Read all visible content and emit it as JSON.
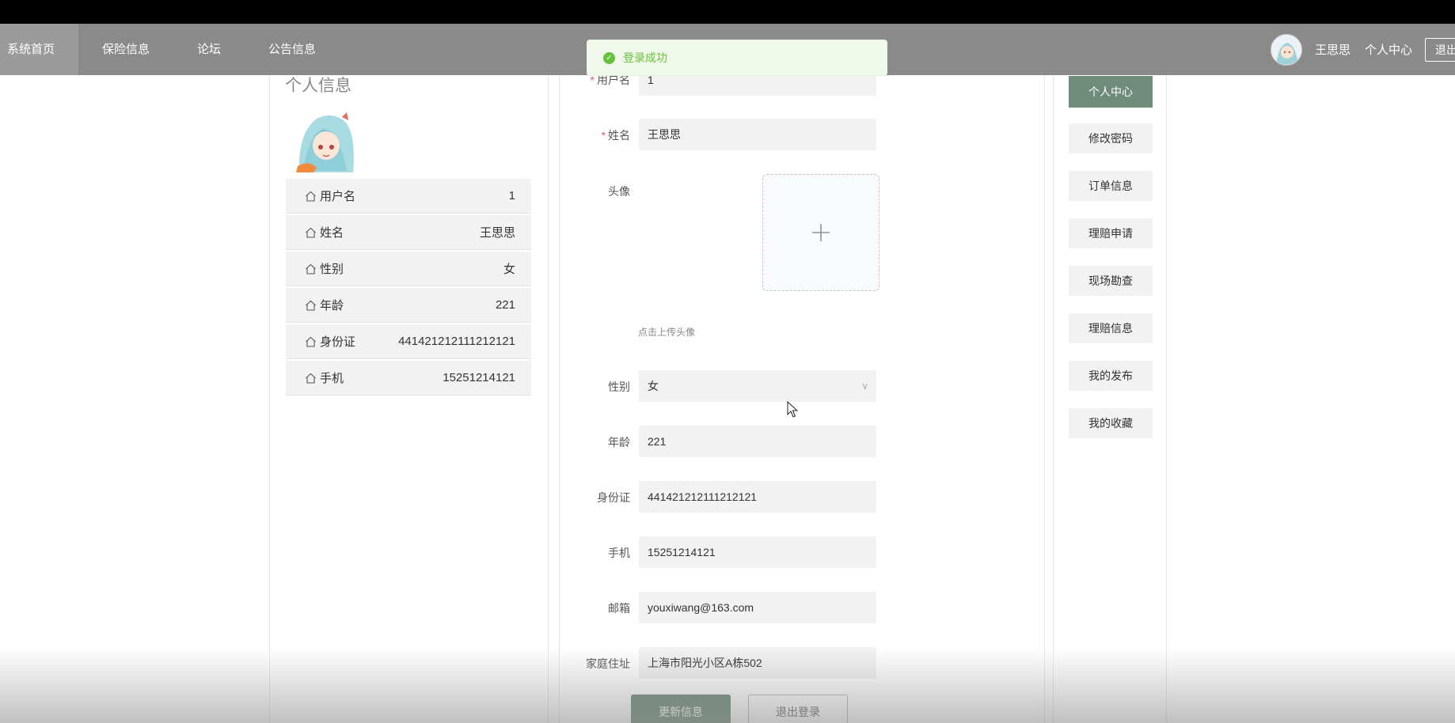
{
  "toast": {
    "message": "登录成功",
    "icon": "check-circle-icon",
    "color": "#67c23a"
  },
  "navbar": {
    "items": [
      {
        "label": "系统首页",
        "active": true
      },
      {
        "label": "保险信息"
      },
      {
        "label": "论坛"
      },
      {
        "label": "公告信息"
      }
    ],
    "username": "王思思",
    "center_label": "个人中心",
    "logout_label": "退出"
  },
  "profile": {
    "title": "个人信息",
    "rows": [
      {
        "label": "用户名",
        "value": "1"
      },
      {
        "label": "姓名",
        "value": "王思思"
      },
      {
        "label": "性别",
        "value": "女"
      },
      {
        "label": "年龄",
        "value": "221"
      },
      {
        "label": "身份证",
        "value": "441421212111212121"
      },
      {
        "label": "手机",
        "value": "15251214121"
      }
    ]
  },
  "form": {
    "username": {
      "label": "用户名",
      "value": "1"
    },
    "name": {
      "label": "姓名",
      "value": "王思思"
    },
    "avatar": {
      "label": "头像",
      "hint": "点击上传头像"
    },
    "gender": {
      "label": "性别",
      "value": "女"
    },
    "age": {
      "label": "年龄",
      "value": "221"
    },
    "id_card": {
      "label": "身份证",
      "value": "441421212111212121"
    },
    "phone": {
      "label": "手机",
      "value": "15251214121"
    },
    "email": {
      "label": "邮箱",
      "value": "youxiwang@163.com"
    },
    "address": {
      "label": "家庭住址",
      "value": "上海市阳光小区A栋502"
    },
    "update_button": "更新信息",
    "logout_button": "退出登录"
  },
  "side_menu": {
    "items": [
      {
        "label": "个人中心",
        "active": true
      },
      {
        "label": "修改密码"
      },
      {
        "label": "订单信息"
      },
      {
        "label": "理赔申请"
      },
      {
        "label": "现场勘查"
      },
      {
        "label": "理赔信息"
      },
      {
        "label": "我的发布"
      },
      {
        "label": "我的收藏"
      }
    ]
  },
  "theme": {
    "accent": "#6f8b7b",
    "navbar_bg": "#808080",
    "required": "#e85d5d"
  }
}
